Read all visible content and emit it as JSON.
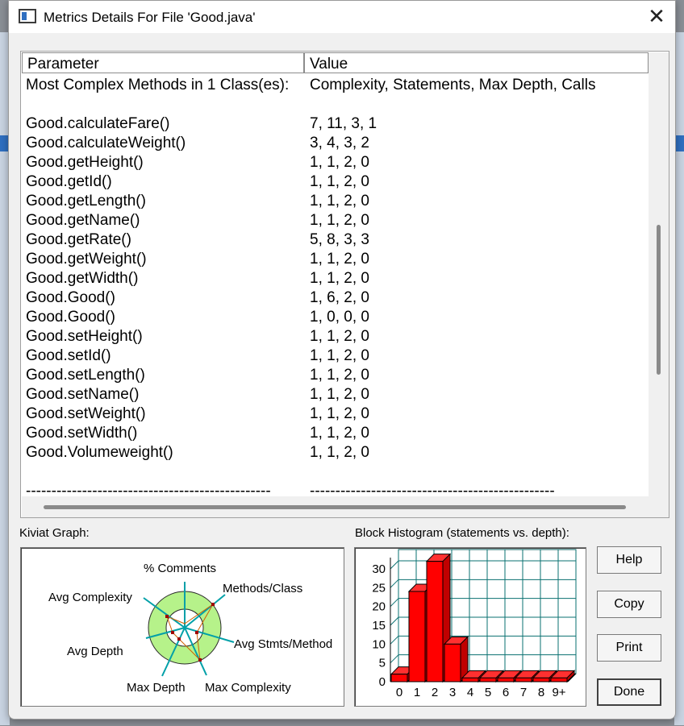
{
  "window": {
    "title": "Metrics Details For File 'Good.java'",
    "close_glyph": "✕"
  },
  "table": {
    "headers": {
      "parameter": "Parameter",
      "value": "Value"
    },
    "rows": [
      {
        "param": "Most Complex Methods in 1 Class(es):",
        "value": "Complexity, Statements, Max Depth, Calls"
      },
      {
        "param": "",
        "value": ""
      },
      {
        "param": "Good.calculateFare()",
        "value": "7, 11, 3, 1"
      },
      {
        "param": "Good.calculateWeight()",
        "value": "3, 4, 3, 2"
      },
      {
        "param": "Good.getHeight()",
        "value": "1, 1, 2, 0"
      },
      {
        "param": "Good.getId()",
        "value": "1, 1, 2, 0"
      },
      {
        "param": "Good.getLength()",
        "value": "1, 1, 2, 0"
      },
      {
        "param": "Good.getName()",
        "value": "1, 1, 2, 0"
      },
      {
        "param": "Good.getRate()",
        "value": "5, 8, 3, 3"
      },
      {
        "param": "Good.getWeight()",
        "value": "1, 1, 2, 0"
      },
      {
        "param": "Good.getWidth()",
        "value": "1, 1, 2, 0"
      },
      {
        "param": "Good.Good()",
        "value": "1, 6, 2, 0"
      },
      {
        "param": "Good.Good()",
        "value": "1, 0, 0, 0"
      },
      {
        "param": "Good.setHeight()",
        "value": "1, 1, 2, 0"
      },
      {
        "param": "Good.setId()",
        "value": "1, 1, 2, 0"
      },
      {
        "param": "Good.setLength()",
        "value": "1, 1, 2, 0"
      },
      {
        "param": "Good.setName()",
        "value": "1, 1, 2, 0"
      },
      {
        "param": "Good.setWeight()",
        "value": "1, 1, 2, 0"
      },
      {
        "param": "Good.setWidth()",
        "value": "1, 1, 2, 0"
      },
      {
        "param": "Good.Volumeweight()",
        "value": "1, 1, 2, 0"
      },
      {
        "param": "",
        "value": ""
      },
      {
        "param": "------------------------------------------------",
        "value": "------------------------------------------------"
      }
    ]
  },
  "kiviat": {
    "label": "Kiviat Graph:",
    "axes": [
      "% Comments",
      "Methods/Class",
      "Avg Stmts/Method",
      "Max Complexity",
      "Max Depth",
      "Avg Depth",
      "Avg Complexity"
    ]
  },
  "histogram": {
    "label": "Block Histogram (statements vs. depth):"
  },
  "buttons": {
    "help": "Help",
    "copy": "Copy",
    "print": "Print",
    "done": "Done"
  },
  "chart_data": {
    "type": "bar",
    "title": "Block Histogram (statements vs. depth):",
    "categories": [
      "0",
      "1",
      "2",
      "3",
      "4",
      "5",
      "6",
      "7",
      "8",
      "9+"
    ],
    "values": [
      2,
      24,
      32,
      10,
      1,
      1,
      1,
      1,
      1,
      1
    ],
    "ylim": [
      0,
      33
    ],
    "yticks": [
      0,
      5,
      10,
      15,
      20,
      25,
      30
    ],
    "grid": true,
    "bar_color": "#ff0000"
  }
}
